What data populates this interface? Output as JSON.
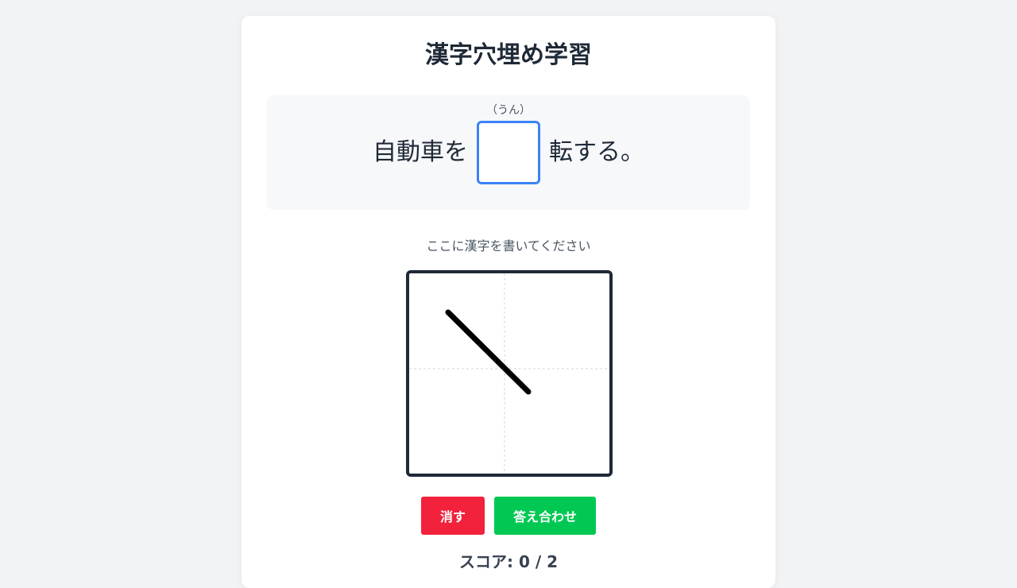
{
  "title": "漢字穴埋め学習",
  "question": {
    "before": "自動車を",
    "furigana": "（うん）",
    "blank_value": "",
    "after": "転する。"
  },
  "instruction": "ここに漢字を書いてください",
  "buttons": {
    "clear_label": "消す",
    "check_label": "答え合わせ"
  },
  "score": {
    "label": "スコア: 0 / 2"
  },
  "colors": {
    "clear": "#f2223c",
    "check": "#00c853",
    "blank_border": "#3b82f6",
    "canvas_border": "#1f2937"
  }
}
